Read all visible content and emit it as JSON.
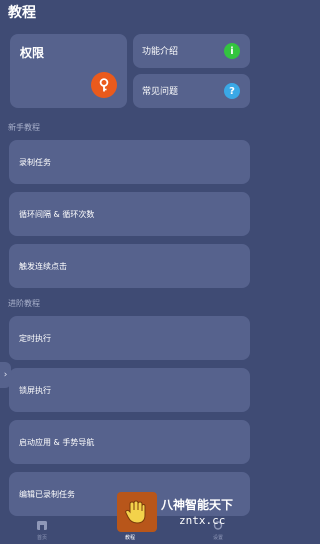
{
  "header": {
    "title": "教程"
  },
  "permission_card": {
    "label": "权限"
  },
  "feature_card": {
    "label": "功能介绍",
    "icon": "info-icon",
    "icon_glyph": "i",
    "color": "#33c43f"
  },
  "faq_card": {
    "label": "常见问题",
    "icon": "help-icon",
    "icon_glyph": "?",
    "color": "#3aa8e6"
  },
  "beginner": {
    "title": "新手教程",
    "items": [
      {
        "label": "录制任务"
      },
      {
        "label": "循环间隔 & 循环次数"
      },
      {
        "label": "触发连续点击"
      }
    ]
  },
  "advanced": {
    "title": "进阶教程",
    "items": [
      {
        "label": "定时执行"
      },
      {
        "label": "锁屏执行"
      },
      {
        "label": "启动应用 & 手势导航"
      },
      {
        "label": "编辑已录制任务"
      }
    ]
  },
  "side_tab": {
    "glyph": "›"
  },
  "nav": {
    "items": [
      {
        "label": "首页",
        "icon": "home-icon"
      },
      {
        "label": "教程",
        "icon": "book-icon",
        "active": true
      },
      {
        "label": "设置",
        "icon": "settings-icon"
      }
    ]
  },
  "watermark": {
    "line1": "八神智能天下",
    "line2": "zntx.cc"
  },
  "colors": {
    "background": "#3f4b74",
    "card": "#56628d",
    "accent_orange": "#ea5a1c"
  }
}
